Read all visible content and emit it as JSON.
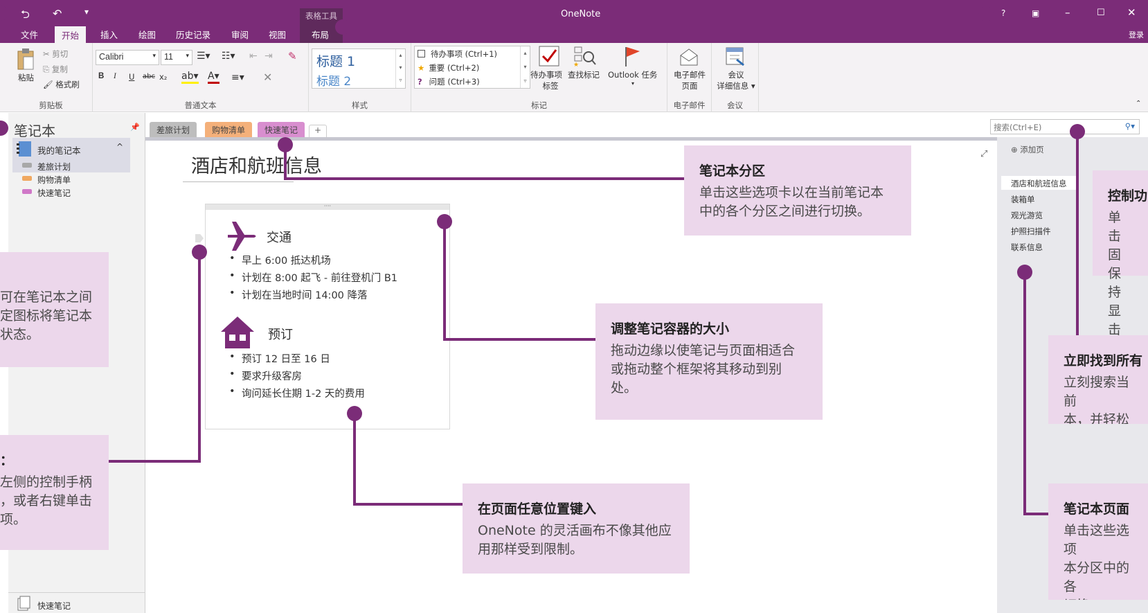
{
  "titlebar": {
    "app_title": "OneNote",
    "context_group": "表格工具",
    "tabs": [
      "文件",
      "开始",
      "插入",
      "绘图",
      "历史记录",
      "审阅",
      "视图",
      "布局"
    ],
    "active_tab": "开始",
    "help": "?",
    "signin": "登录",
    "accent": "#7b2c78"
  },
  "ribbon": {
    "clipboard": {
      "paste": "粘贴",
      "cut": "剪切",
      "copy": "复制",
      "format_painter": "格式刷",
      "label": "剪贴板"
    },
    "basic_text": {
      "font": "Calibri",
      "size": "11",
      "bold": "B",
      "italic": "I",
      "underline": "U",
      "strike": "abc",
      "sub": "x₂",
      "label": "普通文本"
    },
    "styles": {
      "h1": "标题 1",
      "h2": "标题 2",
      "label": "样式"
    },
    "tags": {
      "todo": "待办事项 (Ctrl+1)",
      "important": "重要 (Ctrl+2)",
      "question": "问题 (Ctrl+3)",
      "todo_tag_l1": "待办事项",
      "todo_tag_l2": "标签",
      "find_tags": "查找标记",
      "outlook_tasks": "Outlook 任务",
      "label": "标记"
    },
    "email": {
      "l1": "电子邮件",
      "l2": "页面",
      "label": "电子邮件"
    },
    "meetings": {
      "l1": "会议",
      "l2": "详细信息",
      "label": "会议"
    }
  },
  "notebooks": {
    "header": "笔记本",
    "notebook_name": "我的笔记本",
    "sections": [
      "差旅计划",
      "购物清单",
      "快速笔记"
    ],
    "quick_notes": "快速笔记"
  },
  "section_tabs": [
    "差旅计划",
    "购物清单",
    "快速笔记"
  ],
  "add_tab": "+",
  "search": {
    "placeholder": "搜索(Ctrl+E)"
  },
  "pages": {
    "add_page": "添加页",
    "items": [
      "酒店和航班信息",
      "装箱单",
      "观光游览",
      "护照扫描件",
      "联系信息"
    ]
  },
  "page": {
    "title": "酒店和航班信息",
    "transport_heading": "交通",
    "transport_items": [
      "早上 6:00 抵达机场",
      "计划在 8:00 起飞 - 前往登机门 B1",
      "计划在当地时间 14:00 降落"
    ],
    "booking_heading": "预订",
    "booking_items": [
      "预订 12 日至 16 日",
      "要求升级客房",
      "询问延长住期 1-2 天的费用"
    ]
  },
  "callouts": {
    "sections": {
      "title": "笔记本分区",
      "body": "单击这些选项卡以在当前笔记本中的各个分区之间进行切换。"
    },
    "resize": {
      "title": "调整笔记容器的大小",
      "body": "拖动边缘以使笔记与页面相适合或拖动整个框架将其移动到别处。"
    },
    "type": {
      "title": "在页面任意位置键入",
      "body": "OneNote 的灵活画布不像其他应用那样受到限制。"
    },
    "left_top": {
      "body": "可在笔记本之间\n定图标将笔记本\n状态。"
    },
    "left_bottom": {
      "title": "：",
      "body": "左侧的控制手柄\n，或者右键单击\n项。"
    },
    "right_top": {
      "title": "控制功",
      "body": "单击固\n保持显\n击箭头"
    },
    "right_mid": {
      "title": "立即找到所有",
      "body": "立刻搜索当前\n本，并轻松在"
    },
    "right_bottom": {
      "title": "笔记本页面",
      "body": "单击这些选项\n本分区中的各\n切换。"
    }
  }
}
